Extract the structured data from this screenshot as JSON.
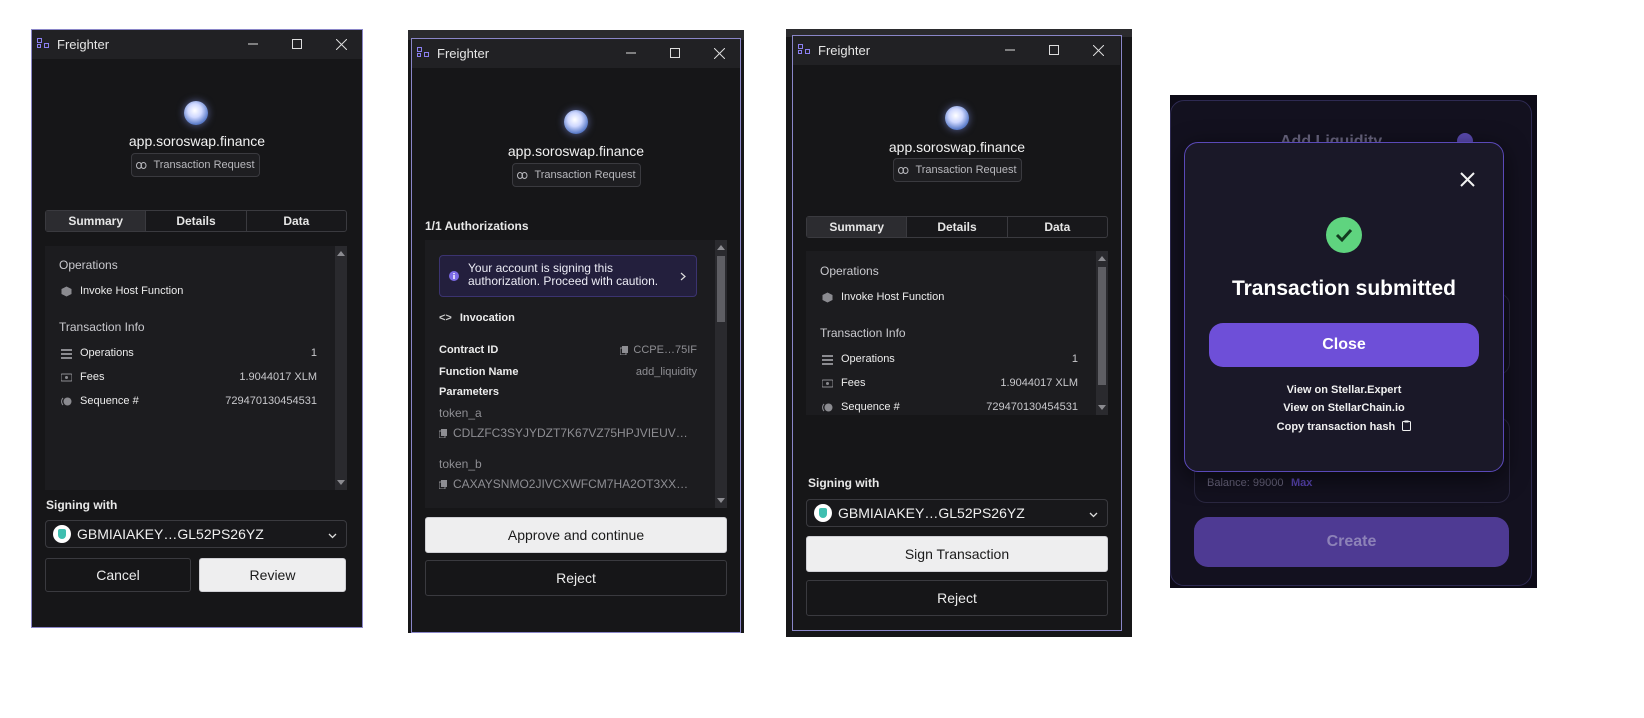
{
  "window_title": "Freighter",
  "site": "app.soroswap.finance",
  "chip": "Transaction Request",
  "tabs": [
    "Summary",
    "Details",
    "Data"
  ],
  "summary": {
    "operations_heading": "Operations",
    "operation": "Invoke Host Function",
    "txinfo_heading": "Transaction Info",
    "rows": [
      {
        "label": "Operations",
        "value": "1"
      },
      {
        "label": "Fees",
        "value": "1.9044017 XLM"
      },
      {
        "label": "Sequence #",
        "value": "729470130454531"
      }
    ]
  },
  "signing_with": "Signing with",
  "account": "GBMIAIAKEY…GL52PS26YZ",
  "window1": {
    "cancel": "Cancel",
    "review": "Review"
  },
  "window2": {
    "heading": "1/1 Authorizations",
    "warning": "Your account is signing this authorization. Proceed with caution.",
    "invocation": "Invocation",
    "contract_label": "Contract ID",
    "contract_value": "CCPE…75IF",
    "function_label": "Function Name",
    "function_value": "add_liquidity",
    "parameters": "Parameters",
    "token_a_label": "token_a",
    "token_a_value": "CDLZFC3SYJYDZT7K67VZ75HPJVIEUV…",
    "token_b_label": "token_b",
    "token_b_value": "CAXAYSNMO2JIVCXWFCM7HA2OT3XX…",
    "approve": "Approve and continue",
    "reject": "Reject"
  },
  "window3": {
    "sign": "Sign Transaction",
    "reject": "Reject"
  },
  "modal": {
    "bg_title": "Add Liquidity",
    "title": "Transaction submitted",
    "close_button": "Close",
    "links": [
      "View on Stellar.Expert",
      "View on StellarChain.io",
      "Copy transaction hash"
    ],
    "balance_label": "Balance: 99000",
    "max_label": "Max",
    "create": "Create"
  },
  "colors": {
    "accent": "#6e4fd8",
    "success": "#5fd47f",
    "window_bg": "#161618"
  }
}
